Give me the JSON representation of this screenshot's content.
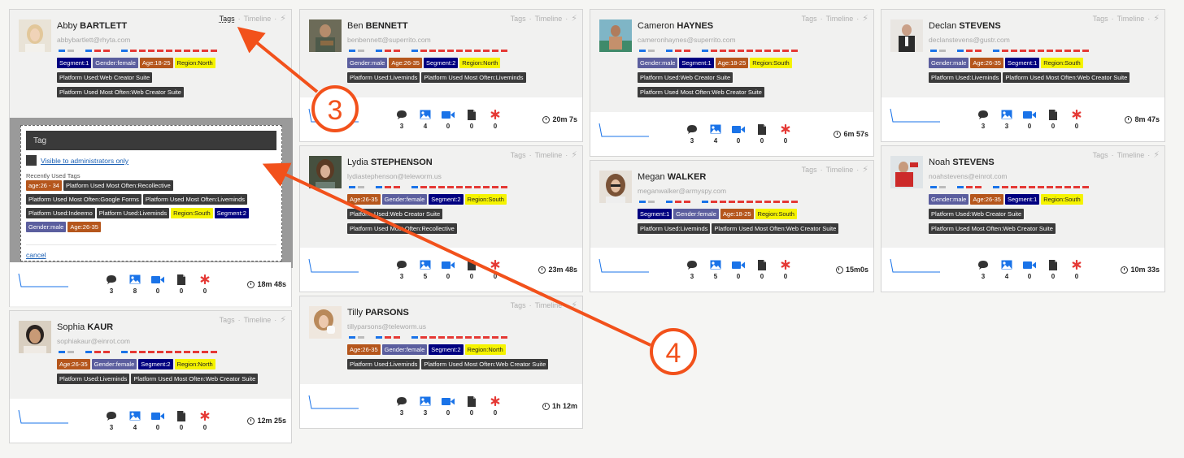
{
  "colors": {
    "segment": "#000080",
    "gender": "#5b5e9e",
    "age": "#b5561c",
    "region": "#f5f300",
    "platform": "#3b3b3b",
    "accent_blue": "#1a73e8",
    "star_red": "#e53935",
    "annotation_orange": "#f2511b"
  },
  "labels": {
    "tags": "Tags",
    "timeline": "Timeline"
  },
  "popup": {
    "title": "Tag",
    "visible_label": "Visible to administrators only",
    "recent_label": "Recently Used Tags",
    "cancel_label": "cancel",
    "recent_tags": [
      [
        "age:26 - 34",
        "Platform Used Most Often:Recollective"
      ],
      [
        "Platform Used Most Often:Google Forms",
        "Platform Used Most Often:Liveminds"
      ],
      [
        "Platform Used:Indeemo",
        "Platform Used:Liveminds",
        "Region:South",
        "Segment:2"
      ],
      [
        "Gender:male",
        "Age:26-35"
      ]
    ]
  },
  "annotations": {
    "callout_3": "3",
    "callout_4": "4"
  },
  "participants": [
    {
      "first": "Abby",
      "last": "BARTLETT",
      "email": "abbybartlett@rhyta.com",
      "tags": [
        [
          "Segment:1",
          "Gender:female",
          "Age:18-25",
          "Region:North"
        ],
        [
          "Platform Used:Web Creator Suite"
        ],
        [
          "Platform Used Most Often:Web Creator Suite"
        ]
      ],
      "stats": [
        "3",
        "8",
        "0",
        "0",
        "0"
      ],
      "time": "18m 48s"
    },
    {
      "first": "Sophia",
      "last": "KAUR",
      "email": "sophiakaur@einrot.com",
      "tags": [
        [
          "Age:26-35",
          "Gender:female",
          "Segment:2",
          "Region:North"
        ],
        [
          "Platform Used:Liveminds",
          "Platform Used Most Often:Web Creator Suite"
        ]
      ],
      "stats": [
        "3",
        "4",
        "0",
        "0",
        "0"
      ],
      "time": "12m 25s"
    },
    {
      "first": "Ben",
      "last": "BENNETT",
      "email": "benbennett@superrito.com",
      "tags": [
        [
          "Gender:male",
          "Age:26-35",
          "Segment:2",
          "Region:North"
        ],
        [
          "Platform Used:Liveminds",
          "Platform Used Most Often:Liveminds"
        ]
      ],
      "stats": [
        "3",
        "4",
        "0",
        "0",
        "0"
      ],
      "time": "20m 7s"
    },
    {
      "first": "Lydia",
      "last": "STEPHENSON",
      "email": "lydiastephenson@teleworm.us",
      "tags": [
        [
          "Age:26-35",
          "Gender:female",
          "Segment:2",
          "Region:South"
        ],
        [
          "Platform Used:Web Creator Suite"
        ],
        [
          "Platform Used Most Often:Recollective"
        ]
      ],
      "stats": [
        "3",
        "5",
        "0",
        "0",
        "0"
      ],
      "time": "23m 48s"
    },
    {
      "first": "Tilly",
      "last": "PARSONS",
      "email": "tillyparsons@teleworm.us",
      "tags": [
        [
          "Age:26-35",
          "Gender:female",
          "Segment:2",
          "Region:North"
        ],
        [
          "Platform Used:Liveminds",
          "Platform Used Most Often:Web Creator Suite"
        ]
      ],
      "stats": [
        "3",
        "3",
        "0",
        "0",
        "0"
      ],
      "time": "1h 12m"
    },
    {
      "first": "Cameron",
      "last": "HAYNES",
      "email": "cameronhaynes@superrito.com",
      "tags": [
        [
          "Gender:male",
          "Segment:1",
          "Age:18-25",
          "Region:South"
        ],
        [
          "Platform Used:Web Creator Suite"
        ],
        [
          "Platform Used Most Often:Web Creator Suite"
        ]
      ],
      "stats": [
        "3",
        "4",
        "0",
        "0",
        "0"
      ],
      "time": "6m 57s"
    },
    {
      "first": "Megan",
      "last": "WALKER",
      "email": "meganwalker@armyspy.com",
      "tags": [
        [
          "Segment:1",
          "Gender:female",
          "Age:18-25",
          "Region:South"
        ],
        [
          "Platform Used:Liveminds",
          "Platform Used Most Often:Web Creator Suite"
        ]
      ],
      "stats": [
        "3",
        "5",
        "0",
        "0",
        "0"
      ],
      "time": "15m0s"
    },
    {
      "first": "Declan",
      "last": "STEVENS",
      "email": "declanstevens@gustr.com",
      "tags": [
        [
          "Gender:male",
          "Age:26-35",
          "Segment:1",
          "Region:South"
        ],
        [
          "Platform Used:Liveminds",
          "Platform Used Most Often:Web Creator Suite"
        ]
      ],
      "stats": [
        "3",
        "3",
        "0",
        "0",
        "0"
      ],
      "time": "8m 47s"
    },
    {
      "first": "Noah",
      "last": "STEVENS",
      "email": "noahstevens@einrot.com",
      "tags": [
        [
          "Gender:male",
          "Age:26-35",
          "Segment:1",
          "Region:South"
        ],
        [
          "Platform Used:Web Creator Suite"
        ],
        [
          "Platform Used Most Often:Web Creator Suite"
        ]
      ],
      "stats": [
        "3",
        "4",
        "0",
        "0",
        "0"
      ],
      "time": "10m 33s"
    }
  ]
}
